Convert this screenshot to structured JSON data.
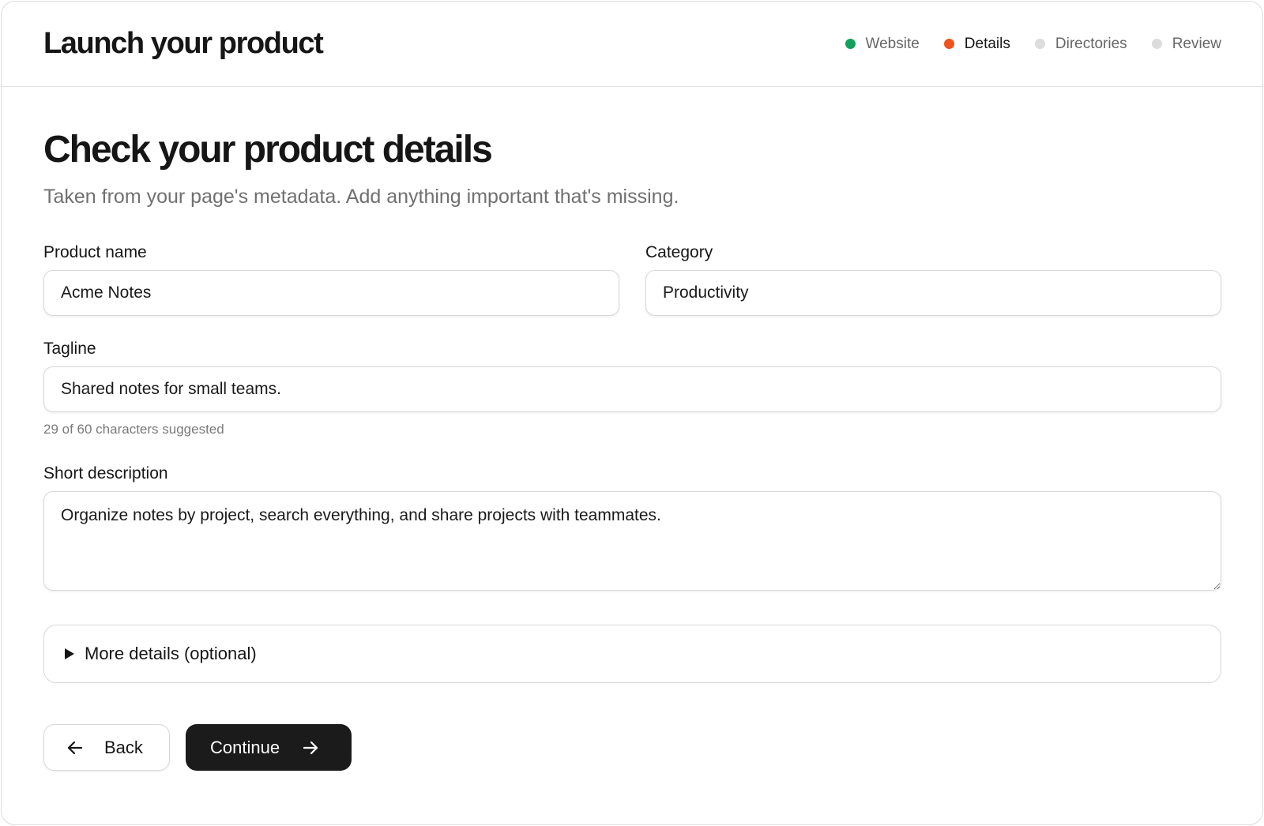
{
  "header": {
    "title": "Launch your product",
    "steps": [
      {
        "label": "Website",
        "color": "#12a05c",
        "state": "complete"
      },
      {
        "label": "Details",
        "color": "#f0531c",
        "state": "current"
      },
      {
        "label": "Directories",
        "color": "#dcdcdc",
        "state": "upcoming"
      },
      {
        "label": "Review",
        "color": "#dcdcdc",
        "state": "upcoming"
      }
    ]
  },
  "main": {
    "title": "Check your product details",
    "subtitle": "Taken from your page's metadata. Add anything important that's missing.",
    "fields": {
      "product_name": {
        "label": "Product name",
        "value": "Acme Notes"
      },
      "category": {
        "label": "Category",
        "value": "Productivity"
      },
      "tagline": {
        "label": "Tagline",
        "value": "Shared notes for small teams.",
        "hint": "29 of 60 characters suggested"
      },
      "short_description": {
        "label": "Short description",
        "value": "Organize notes by project, search everything, and share projects with teammates."
      }
    },
    "more_details": {
      "label": "More details (optional)",
      "icon": "disclosure-triangle-icon"
    }
  },
  "actions": {
    "back": {
      "label": "Back",
      "icon": "arrow-left-icon"
    },
    "continue": {
      "label": "Continue",
      "icon": "arrow-right-icon"
    }
  }
}
